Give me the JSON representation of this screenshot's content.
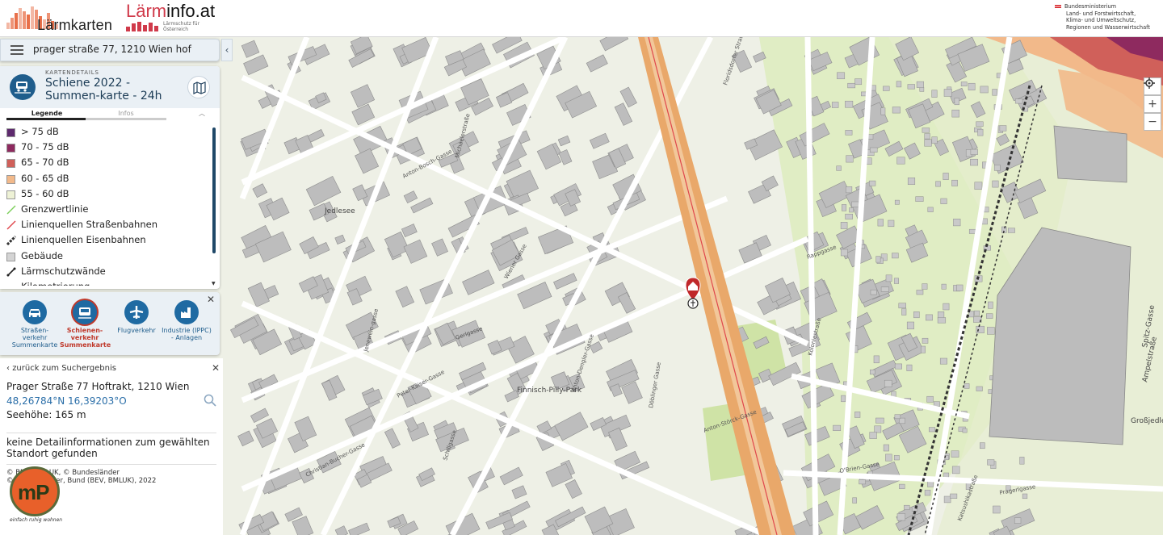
{
  "header": {
    "logo_laermkarten": "Lärmkarten",
    "logo_laerminfo_prefix": "Lärm",
    "logo_laerminfo_suffix": "info.at",
    "logo_laerminfo_tagline": "Lärmschutz für Österreich",
    "ministry_lines": [
      "Bundesministerium",
      "Land- und Forstwirtschaft,",
      "Klima- und Umweltschutz,",
      "Regionen und Wasserwirtschaft"
    ]
  },
  "search": {
    "value": "prager straße 77, 1210 Wien hof"
  },
  "details": {
    "kicker": "KARTENDETAILS",
    "title": "Schiene 2022 - Summen-karte - 24h",
    "tabs": [
      "Legende",
      "Infos"
    ],
    "legend": [
      {
        "label": "> 75 dB",
        "kind": "swatch",
        "color": "#5e2a6e"
      },
      {
        "label": "70 - 75 dB",
        "kind": "swatch",
        "color": "#8e2a5f"
      },
      {
        "label": "65 - 70 dB",
        "kind": "swatch",
        "color": "#d0605a"
      },
      {
        "label": "60 - 65 dB",
        "kind": "swatch",
        "color": "#f2b98a"
      },
      {
        "label": "55 - 60 dB",
        "kind": "swatch",
        "color": "#eef2d6"
      },
      {
        "label": "Grenzwertlinie",
        "kind": "line",
        "color": "#7ccf5a"
      },
      {
        "label": "Linienquellen Straßenbahnen",
        "kind": "line",
        "color": "#e0474c"
      },
      {
        "label": "Linienquellen Eisenbahnen",
        "kind": "dashline",
        "color": "#333333"
      },
      {
        "label": "Gebäude",
        "kind": "swatch",
        "color": "#d4d4d4"
      },
      {
        "label": "Lärmschutzwände",
        "kind": "wall",
        "color": "#222222"
      },
      {
        "label": "Kilometrierung",
        "kind": "dot",
        "color": "#c0392b"
      }
    ]
  },
  "layers": [
    {
      "label": "Straßen-verkehr Summenkarte",
      "icon": "car-icon",
      "active": false
    },
    {
      "label": "Schienen-verkehr Summenkarte",
      "icon": "train-icon",
      "active": true
    },
    {
      "label": "Flugverkehr",
      "icon": "plane-icon",
      "active": false
    },
    {
      "label": "Industrie (IPPC) - Anlagen",
      "icon": "factory-icon",
      "active": false
    }
  ],
  "info": {
    "back_label": "zurück zum Suchergebnis",
    "address": "Prager Straße 77 Hoftrakt, 1210 Wien",
    "coordinates": "48,26784°N 16,39203°O",
    "elevation": "Seehöhe: 165 m",
    "no_details": "keine Detailinformationen zum gewählten Standort gefunden",
    "attribution_1": "© BMK, BMLUK, © Bundesländer",
    "attribution_2": "© Bundesländer, Bund (BEV, BMLUK), 2022"
  },
  "watermark": {
    "logo_text": "mP",
    "tagline": "einfach ruhig wohnen"
  },
  "map": {
    "street_labels": [
      "Anton-Bosch-Gasse",
      "Michaelerstraße",
      "Floridsdorfer Straße",
      "Wiener Gasse",
      "Jenewein-gasse",
      "Gerlgasse",
      "Peter-Kaiser-Gasse",
      "Anton-Dengler-Gasse",
      "Rappgasse",
      "Koloniestraße",
      "Döblinger Gasse",
      "Anton-Störck-Gasse",
      "Christian-Bucher-Gasse",
      "Schillgasse",
      "Katsushikastraße",
      "O'Brien-Gasse",
      "Pragerlgasse",
      "Finnisch-Pilly-Park",
      "Großjedlersdorf II",
      "Jedlesee",
      "Ampelstraße",
      "Spitz-Gasse"
    ]
  },
  "colors": {
    "map_base": "#eef0e6",
    "building": "#bdbdbd",
    "rail_noise_orange": "#f2b98a",
    "accent_blue": "#1f6aa2",
    "marker_red": "#c0282a"
  }
}
